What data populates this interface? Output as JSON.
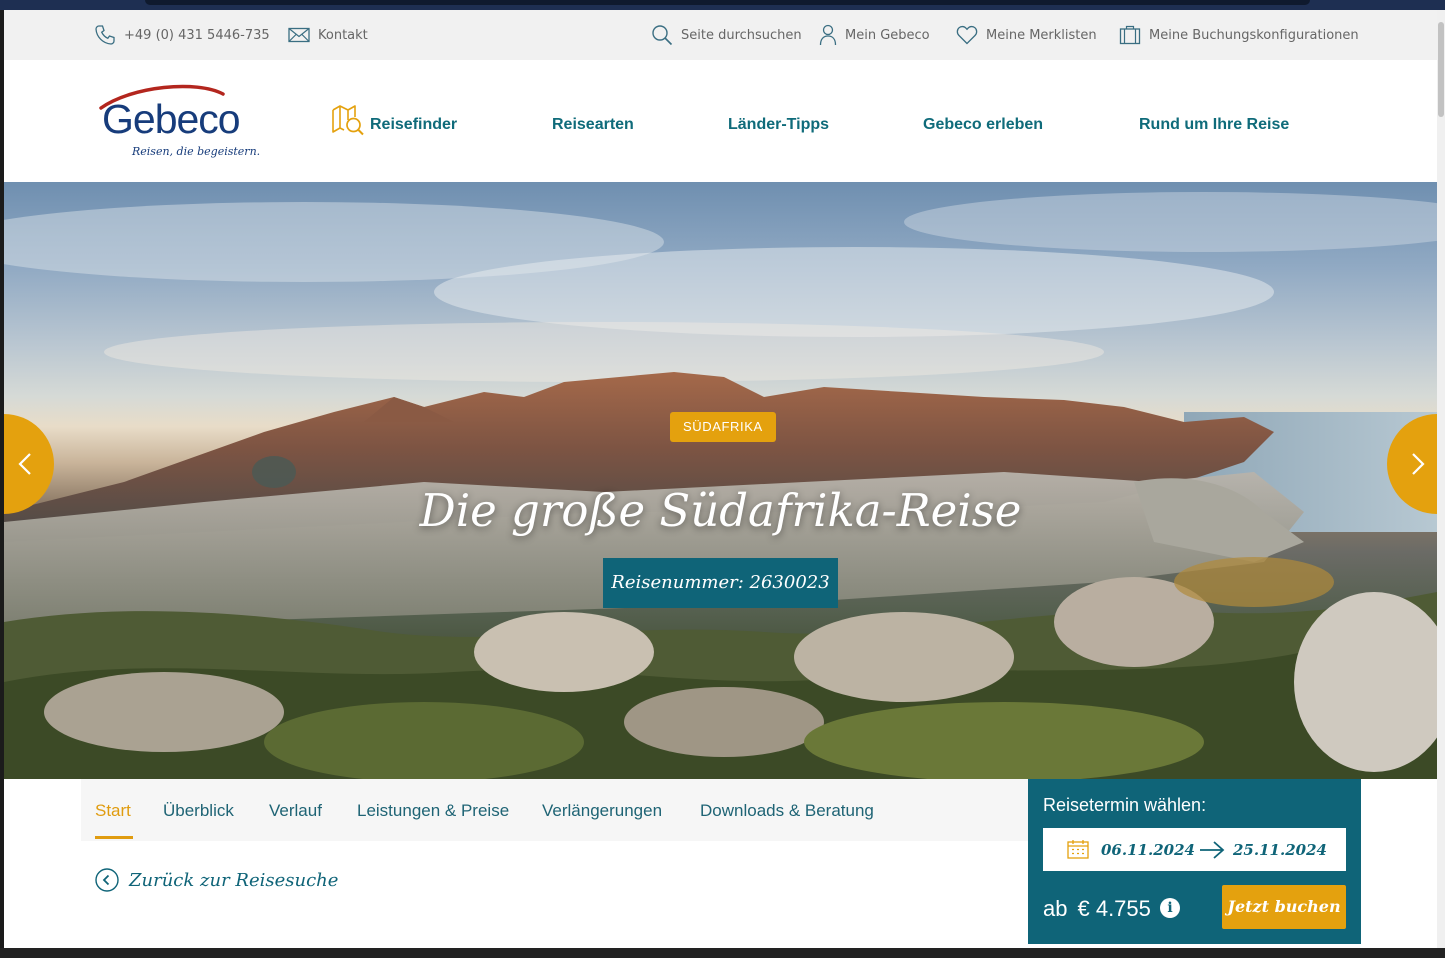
{
  "utility_bar": {
    "phone": "+49 (0) 431 5446-735",
    "contact": "Kontakt",
    "search": "Seite durchsuchen",
    "account": "Mein Gebeco",
    "wishlists": "Meine Merklisten",
    "bookings": "Meine Buchungskonfigurationen"
  },
  "logo": {
    "name": "Gebeco",
    "tagline": "Reisen, die begeistern."
  },
  "main_nav": {
    "items": [
      {
        "label": "Reisefinder",
        "icon": "map-search-icon"
      },
      {
        "label": "Reisearten"
      },
      {
        "label": "Länder-Tipps"
      },
      {
        "label": "Gebeco erleben"
      },
      {
        "label": "Rund um Ihre Reise"
      }
    ]
  },
  "hero": {
    "country_badge": "SÜDAFRIKA",
    "title": "Die große Südafrika-Reise",
    "trip_number": "Reisenummer: 2630023",
    "prev_icon": "chevron-left-icon",
    "next_icon": "chevron-right-icon"
  },
  "tabs": {
    "items": [
      "Start",
      "Überblick",
      "Verlauf",
      "Leistungen & Preise",
      "Verlängerungen",
      "Downloads & Beratung"
    ],
    "active_index": 0
  },
  "back_link": {
    "label": "Zurück zur Reisesuche"
  },
  "booking": {
    "title": "Reisetermin wählen:",
    "date_from": "06.11.2024",
    "date_to": "25.11.2024",
    "price_prefix": "ab",
    "price": "€ 4.755",
    "info_icon": "i",
    "book_button": "Jetzt buchen"
  },
  "colors": {
    "teal": "#0f6478",
    "nav_teal": "#0f6b7a",
    "accent": "#e4a10e",
    "logo_blue": "#173c7b",
    "logo_red": "#b3261e"
  }
}
